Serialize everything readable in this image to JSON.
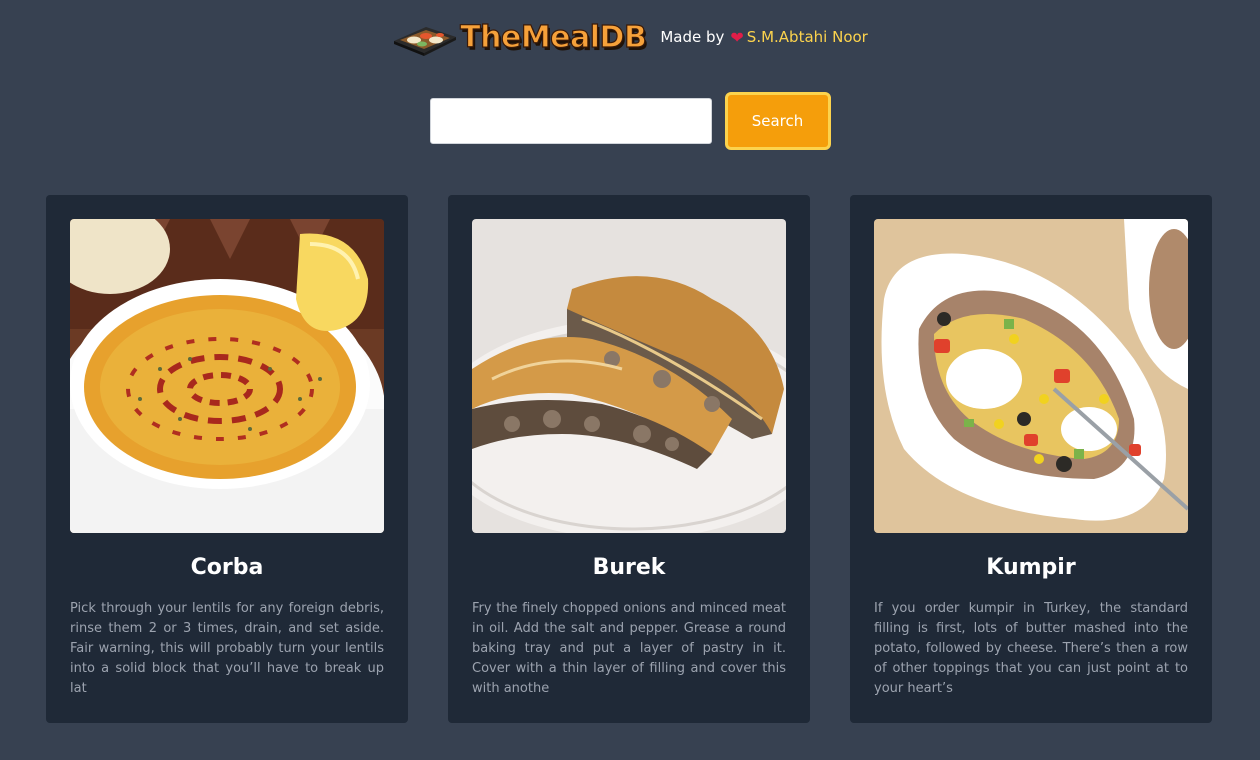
{
  "header": {
    "logo_text": "TheMealDB",
    "made_by_label": "Made by",
    "heart_icon": "heart-icon",
    "author": "S.M.Abtahi Noor"
  },
  "search": {
    "value": "",
    "placeholder": "",
    "button_label": "Search"
  },
  "colors": {
    "background": "#374151",
    "card": "#1f2937",
    "accent": "#f59e0b",
    "accent_border": "#fcd34d",
    "author": "#fcd34d"
  },
  "meals": [
    {
      "name": "Corba",
      "description": "Pick through your lentils for any foreign debris, rinse them 2 or 3 times, drain, and set aside. Fair warning, this will probably turn your lentils into a solid block that you’ll have to break up lat"
    },
    {
      "name": "Burek",
      "description": "Fry the finely chopped onions and minced meat in oil. Add the salt and pepper. Grease a round baking tray and put a layer of pastry in it. Cover with a thin layer of filling and cover this with anothe"
    },
    {
      "name": "Kumpir",
      "description": "If you order kumpir in Turkey, the standard filling is first, lots of butter mashed into the potato, followed by cheese. There’s then a row of other toppings that you can just point at to your heart’s"
    }
  ]
}
